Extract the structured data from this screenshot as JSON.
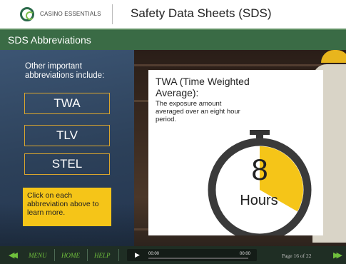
{
  "header": {
    "brand": "CASINO ESSENTIALS",
    "title": "Safety Data Sheets (SDS)"
  },
  "section": {
    "title": "SDS Abbreviations"
  },
  "left_panel": {
    "intro": "Other important abbreviations include:",
    "buttons": [
      {
        "label": "TWA"
      },
      {
        "label": "TLV"
      },
      {
        "label": "STEL"
      }
    ],
    "hint": "Click on each abbreviation above to learn more."
  },
  "card": {
    "title": "TWA (Time Weighted Average):",
    "description": "The exposure amount averaged over an eight hour period.",
    "timer_value": "8",
    "timer_unit": "Hours",
    "timer_fraction": 0.333
  },
  "player": {
    "menu": "MENU",
    "home": "HOME",
    "help": "HELP",
    "time_start": "00:00",
    "time_end": "00:00",
    "page": "Page 16 of 22",
    "progress": 0
  },
  "colors": {
    "accent_green": "#6fbf3c",
    "section_green": "#3a6b45",
    "highlight_yellow": "#f5c518",
    "button_border": "#d9a52e"
  },
  "icons": {
    "logo": "casino-essentials-logo",
    "prev": "double-left-arrow",
    "next": "double-right-arrow",
    "play": "play-triangle",
    "timer": "stopwatch"
  }
}
